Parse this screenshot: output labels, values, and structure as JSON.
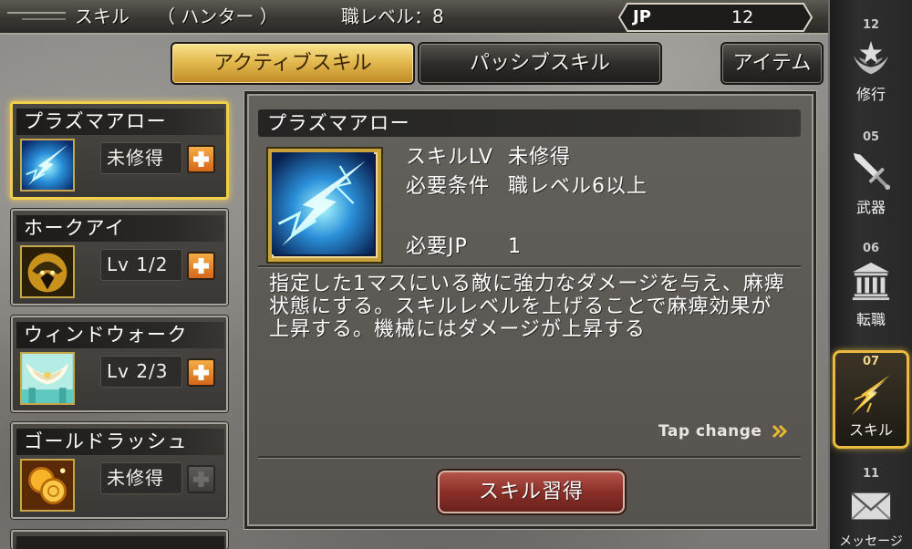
{
  "header": {
    "title": "スキル",
    "job": "（ ハンター ）",
    "job_level": "職レベル：8",
    "jp_label": "JP",
    "jp_value": "12"
  },
  "tabs": [
    {
      "label": "アクティブスキル",
      "active": true
    },
    {
      "label": "パッシブスキル",
      "active": false
    },
    {
      "label": "アイテム",
      "active": false
    }
  ],
  "skills": [
    {
      "name": "プラズマアロー",
      "status": "未修得",
      "icon": "plasma-arrow-icon",
      "selected": true,
      "can_learn": true
    },
    {
      "name": "ホークアイ",
      "status": "Lv 1/2",
      "icon": "hawk-eye-icon",
      "selected": false,
      "can_learn": true
    },
    {
      "name": "ウィンドウォーク",
      "status": "Lv 2/3",
      "icon": "wind-walk-icon",
      "selected": false,
      "can_learn": true
    },
    {
      "name": "ゴールドラッシュ",
      "status": "未修得",
      "icon": "gold-rush-icon",
      "selected": false,
      "can_learn": false
    }
  ],
  "detail": {
    "title": "プラズマアロー",
    "icon": "plasma-arrow-icon",
    "skill_lv_label": "スキルLV",
    "skill_lv_value": "未修得",
    "requirement_label": "必要条件",
    "requirement_value": "職レベル6以上",
    "jp_label": "必要JP",
    "jp_value": "1",
    "description_lines": [
      "指定した1マスにいる敵に強力なダメージを与え、麻痺",
      "状態にする。スキルレベルを上げることで麻痺効果が",
      "上昇する。機械にはダメージが上昇する"
    ],
    "tap_change": "Tap change",
    "learn_button": "スキル習得"
  },
  "sidebar": {
    "items": [
      {
        "badge": "12",
        "label": "修行",
        "icon": "training-icon",
        "active": false
      },
      {
        "badge": "05",
        "label": "武器",
        "icon": "sword-icon",
        "active": false
      },
      {
        "badge": "06",
        "label": "転職",
        "icon": "temple-icon",
        "active": false
      },
      {
        "badge": "07",
        "label": "スキル",
        "icon": "skill-icon",
        "active": true
      },
      {
        "badge": "11",
        "label": "メッセージ",
        "icon": "envelope-icon",
        "active": false
      }
    ]
  },
  "colors": {
    "accent_gold": "#e8bb3c",
    "learn_button": "#8a2f28",
    "plus_button": "#d4661a"
  }
}
